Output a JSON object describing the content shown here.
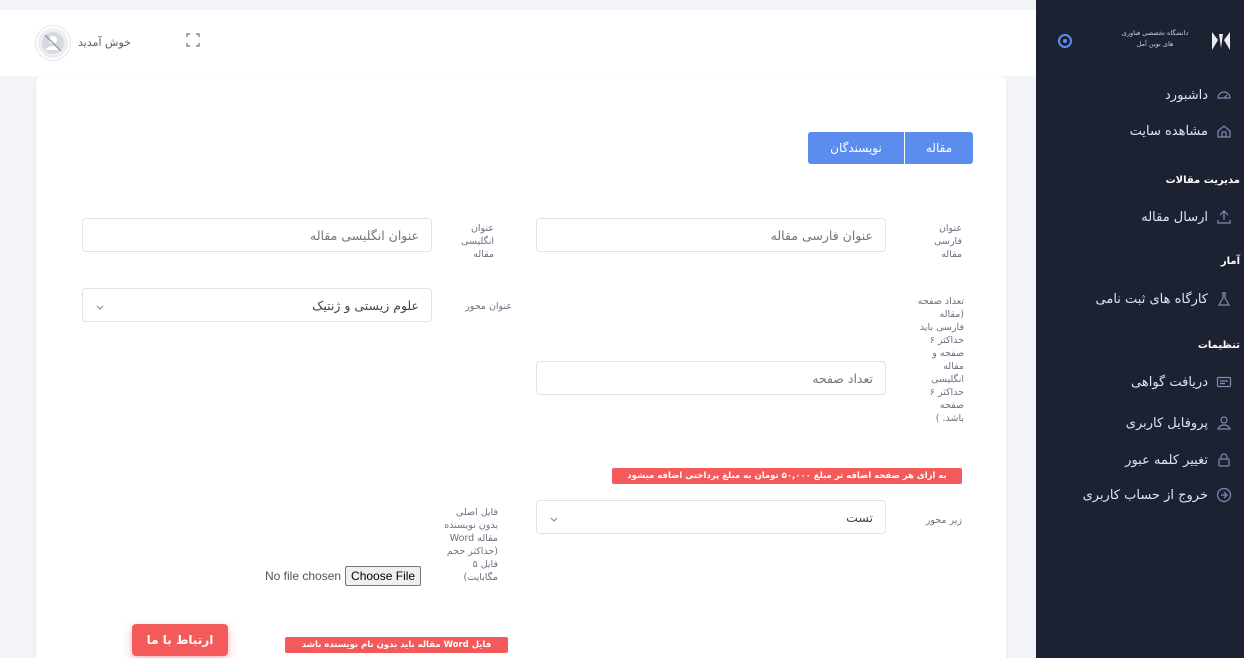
{
  "topbar": {
    "welcome": "خوش آمدید",
    "avatar_icon": "user-avatar-icon",
    "fullscreen_icon": "fullscreen-icon"
  },
  "sidebar": {
    "brand_line1": "دانشگاه تخصصی فناوری",
    "brand_line2": "های نوین آمل",
    "items": [
      {
        "label": "داشبورد",
        "icon": "dashboard-icon"
      },
      {
        "label": "مشاهده سایت",
        "icon": "home-icon"
      },
      {
        "label": "ارسال مقاله",
        "icon": "upload-icon"
      },
      {
        "label": "کارگاه های ثبت نامی",
        "icon": "flask-icon"
      },
      {
        "label": "دریافت گواهی",
        "icon": "certificate-icon"
      },
      {
        "label": "پروفایل کاربری",
        "icon": "user-icon"
      },
      {
        "label": "تغییر کلمه عبور",
        "icon": "lock-icon"
      },
      {
        "label": "خروج از حساب کاربری",
        "icon": "logout-icon"
      }
    ],
    "sections": {
      "articles": "مدیریت مقالات",
      "stats": "آمار",
      "settings": "تنظیمات"
    }
  },
  "form": {
    "tabs": [
      "مقاله",
      "نویسندگان"
    ],
    "persian_title_label": "عنوان فارسی مقاله",
    "persian_title_placeholder": "عنوان فارسی مقاله",
    "english_title_label": "عنوان انگلیسی مقاله",
    "english_title_placeholder": "عنوان انگلیسی مقاله",
    "axis_label": "عنوان محور",
    "axis_value": "علوم زیستی و ژنتیک",
    "page_count_label": "تعداد صفحه (مقاله فارسی باید حداکثر ۶ صفحه و مقاله انگلیسی حداکثر ۶ صفحه باشد. )",
    "page_count_placeholder": "تعداد صفحه",
    "page_count_alert": "به ازای هر صفحه اضافه تر مبلغ ۵۰,۰۰۰ تومان به مبلغ پرداختی اضافه میشود",
    "subaxis_label": "زیر محور",
    "subaxis_value": "تست",
    "file_label": "فایل اصلی بدون نویسنده مقاله Word (حداکثر حجم فایل ۵ مگابایت)",
    "file_button": "Choose File",
    "file_status": "No file chosen",
    "file_alert": "فایل Word مقاله باید بدون نام نویسنده باشد"
  },
  "contact_button": "ارتباط با ما",
  "colors": {
    "sidebar_bg": "#1d2233",
    "primary": "#5a8dee",
    "danger": "#f55a5a"
  }
}
